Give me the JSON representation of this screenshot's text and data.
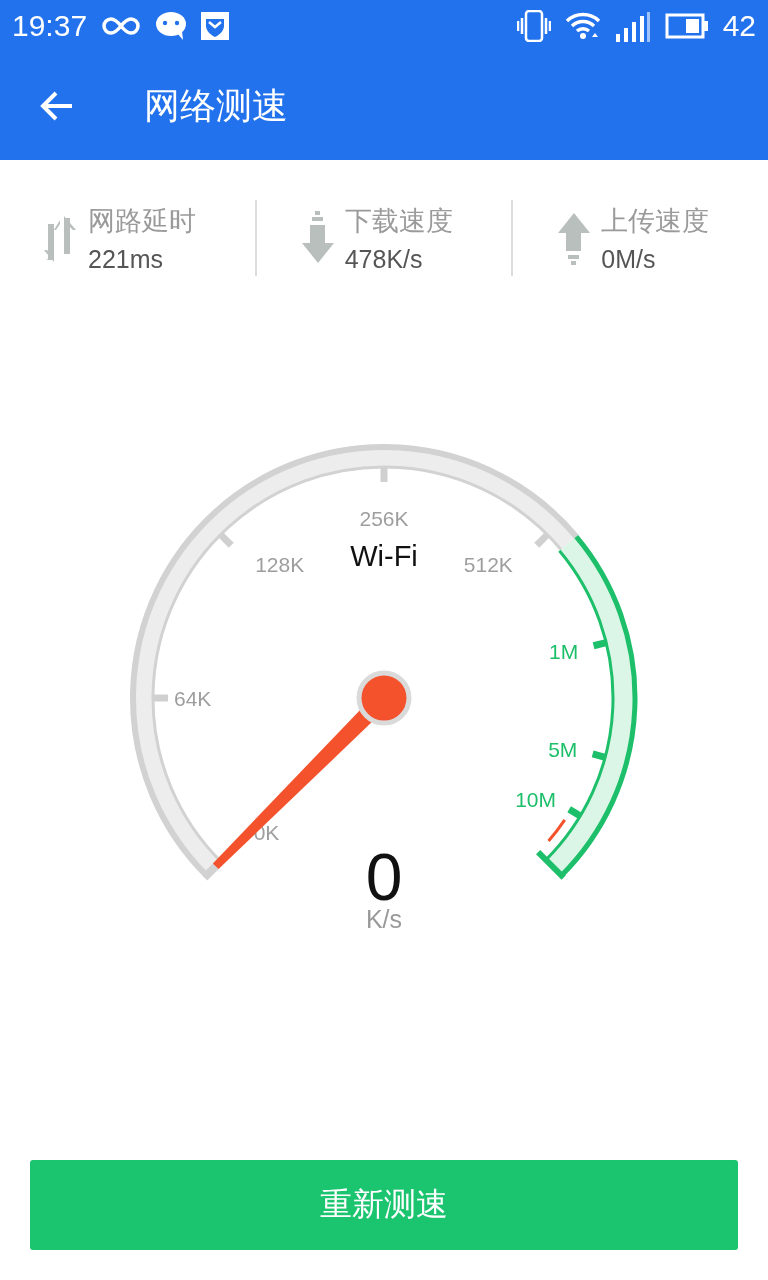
{
  "status_bar": {
    "time": "19:37",
    "battery": "42"
  },
  "app_bar": {
    "title": "网络测速"
  },
  "stats": [
    {
      "kind": "latency",
      "label": "网路延时",
      "value": "221ms"
    },
    {
      "kind": "download",
      "label": "下载速度",
      "value": "478K/s"
    },
    {
      "kind": "upload",
      "label": "上传速度",
      "value": "0M/s"
    }
  ],
  "gauge": {
    "network": "Wi-Fi",
    "reading": "0",
    "unit": "K/s",
    "scale": [
      {
        "label": "0K",
        "color": "#9e9e9e"
      },
      {
        "label": "64K",
        "color": "#9e9e9e"
      },
      {
        "label": "128K",
        "color": "#9e9e9e"
      },
      {
        "label": "256K",
        "color": "#9e9e9e"
      },
      {
        "label": "512K",
        "color": "#9e9e9e"
      },
      {
        "label": "1M",
        "color": "#1dbf6a"
      },
      {
        "label": "5M",
        "color": "#1dbf6a"
      },
      {
        "label": "10M",
        "color": "#1dbf6a"
      }
    ]
  },
  "button": {
    "label": "重新测速"
  }
}
